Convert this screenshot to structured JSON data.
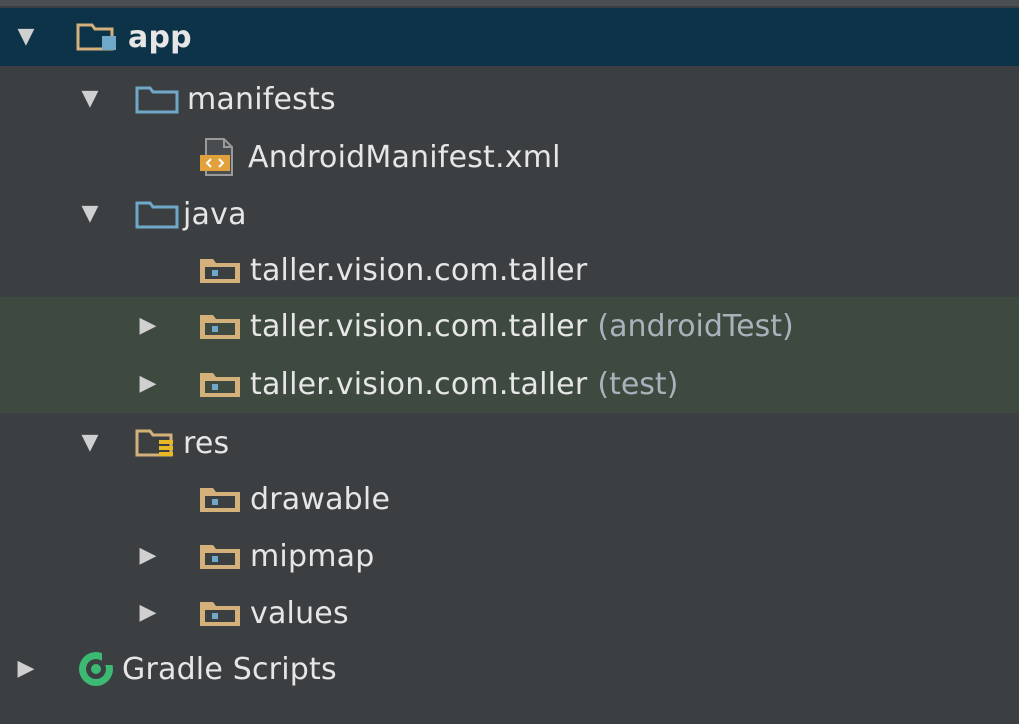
{
  "tree": {
    "app": {
      "label": "app"
    },
    "manifests": {
      "label": "manifests"
    },
    "android_manifest": {
      "label": "AndroidManifest.xml"
    },
    "java": {
      "label": "java"
    },
    "pkg_main": {
      "label": "taller.vision.com.taller"
    },
    "pkg_android_test": {
      "label": "taller.vision.com.taller",
      "suffix": "(androidTest)"
    },
    "pkg_test": {
      "label": "taller.vision.com.taller",
      "suffix": "(test)"
    },
    "res": {
      "label": "res"
    },
    "drawable": {
      "label": "drawable"
    },
    "mipmap": {
      "label": "mipmap"
    },
    "values": {
      "label": "values"
    },
    "gradle_scripts": {
      "label": "Gradle Scripts"
    }
  },
  "icons": {
    "expanded": "triangle-down-icon",
    "collapsed": "triangle-right-icon",
    "module_folder": "module-folder-icon",
    "folder": "folder-icon",
    "package": "package-folder-icon",
    "resources_folder": "resources-folder-icon",
    "xml_file": "xml-file-icon",
    "gradle": "gradle-icon"
  },
  "colors": {
    "background": "#3c3f41",
    "selected_row": "#0d3349",
    "test_rows": "#3e4940",
    "folder_blue": "#6fa8c8",
    "package_tan": "#d4b07a",
    "gradle_green": "#3cba74"
  }
}
